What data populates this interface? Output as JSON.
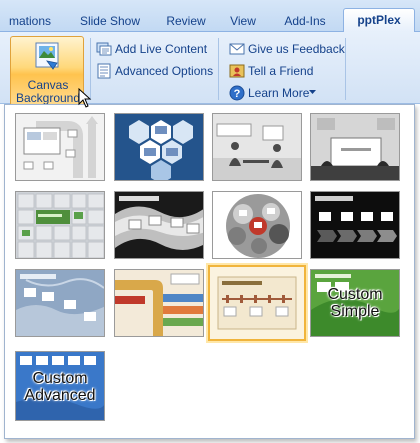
{
  "tabs": [
    {
      "label": "mations",
      "active": false
    },
    {
      "label": "Slide Show",
      "active": false
    },
    {
      "label": "Review",
      "active": false
    },
    {
      "label": "View",
      "active": false
    },
    {
      "label": "Add-Ins",
      "active": false
    },
    {
      "label": "pptPlex",
      "active": true
    }
  ],
  "ribbon": {
    "canvas_background": {
      "line1": "Canvas",
      "line2": "Background",
      "icon": "canvas-background-icon"
    },
    "add_live_content": {
      "label": "Add Live Content",
      "icon": "live-content-icon"
    },
    "advanced_options": {
      "label": "Advanced Options",
      "icon": "advanced-options-icon"
    },
    "give_feedback": {
      "label": "Give us Feedback",
      "icon": "feedback-icon"
    },
    "tell_friend": {
      "label": "Tell a Friend",
      "icon": "tell-friend-icon"
    },
    "learn_more": {
      "label": "Learn More",
      "icon": "help-icon",
      "dropdown": "chevron-down-icon"
    }
  },
  "gallery": {
    "selected_index": 10,
    "items": [
      {
        "name": "Flow Arrows",
        "label": ""
      },
      {
        "name": "Blue Hexagons",
        "label": ""
      },
      {
        "name": "Meeting Silhouettes",
        "label": ""
      },
      {
        "name": "Presentation Screen",
        "label": ""
      },
      {
        "name": "Tile Grid",
        "label": ""
      },
      {
        "name": "Gray Waves",
        "label": ""
      },
      {
        "name": "Gray Circles",
        "label": ""
      },
      {
        "name": "Black Arrows",
        "label": ""
      },
      {
        "name": "Blue Map",
        "label": ""
      },
      {
        "name": "Ribbons",
        "label": ""
      },
      {
        "name": "Timeline",
        "label": ""
      },
      {
        "name": "Custom Simple",
        "label": "Custom\nSimple"
      },
      {
        "name": "Custom Advanced",
        "label": "Custom\nAdvanced"
      }
    ]
  },
  "custom_simple": {
    "line1": "Custom",
    "line2": "Simple"
  },
  "custom_advanced": {
    "line1": "Custom",
    "line2": "Advanced"
  },
  "colors": {
    "accent": "#15428b",
    "ribbon": "#dbe8f7",
    "selection": "#f0b43c"
  }
}
